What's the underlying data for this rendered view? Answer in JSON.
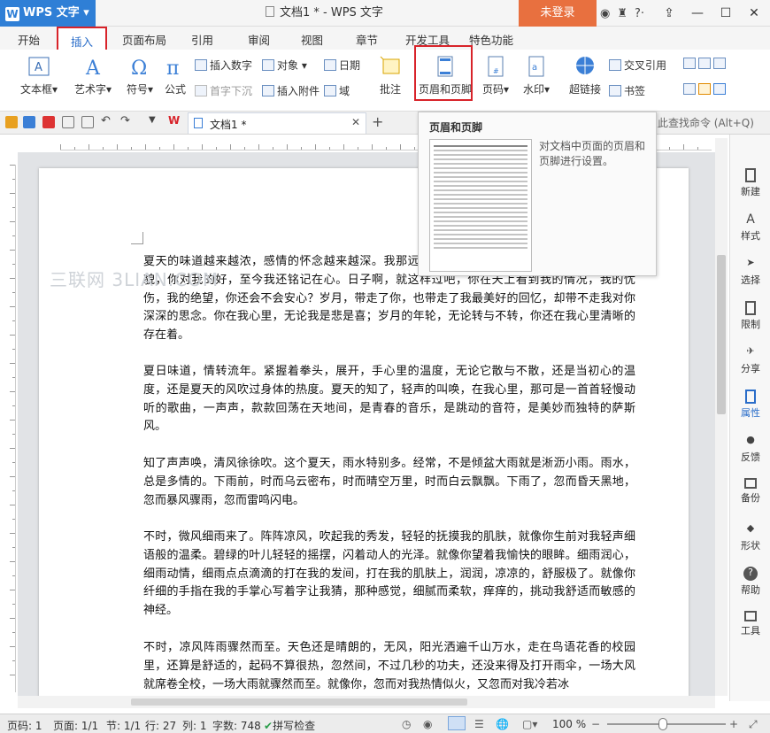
{
  "app": {
    "name": "WPS 文字",
    "window_title": "文档1 * - WPS 文字",
    "login": "未登录"
  },
  "tabs": [
    "开始",
    "插入",
    "页面布局",
    "引用",
    "审阅",
    "视图",
    "章节",
    "开发工具",
    "特色功能"
  ],
  "ribbon": {
    "textbox": "文本框",
    "wordart": "艺术字",
    "symbol": "符号",
    "formula": "公式",
    "insert_number": "插入数字",
    "object": "对象",
    "date": "日期",
    "drop_cap": "首字下沉",
    "insert_attachment": "插入附件",
    "field": "域",
    "comment": "批注",
    "header_footer": "页眉和页脚",
    "page_number": "页码",
    "watermark": "水印",
    "hyperlink": "超链接",
    "cross_ref": "交叉引用",
    "bookmark": "书签"
  },
  "quickbar": {
    "doc_tab": "文档1 *",
    "search_placeholder": "点此查找命令 (Alt+Q)"
  },
  "tooltip": {
    "title": "页眉和页脚",
    "description": "对文档中页面的页眉和页脚进行设置。"
  },
  "document": {
    "watermark": "三联网 3LIAN.COM",
    "paragraphs": [
      "夏天的味道越来越浓，感情的怀念越来越深。我那远去的朋友，你在天国还好吗？你的音容笑貌，你对我的好，至今我还铭记在心。日子啊，就这样过吧，你在天上看到我的情况，我的忧伤，我的绝望，你还会不会安心？岁月，带走了你，也带走了我最美好的回忆，却带不走我对你深深的思念。你在我心里，无论我是悲是喜；岁月的年轮，无论转与不转，你还在我心里清晰的存在着。",
      "夏日味道，情转流年。紧握着拳头，展开，手心里的温度，无论它散与不散，还是当初心的温度，还是夏天的风吹过身体的热度。夏天的知了，轻声的叫唤，在我心里，那可是一首首轻慢动听的歌曲，一声声，款款回荡在天地间，是青春的音乐，是跳动的音符，是美妙而独特的萨斯风。",
      "知了声声唤，清风徐徐吹。这个夏天，雨水特别多。经常，不是倾盆大雨就是淅沥小雨。雨水，总是多情的。下雨前，时而乌云密布，时而晴空万里，时而白云飘飘。下雨了，忽而昏天黑地，忽而暴风骤雨，忽而雷鸣闪电。",
      "不时，微风细雨来了。阵阵凉风，吹起我的秀发，轻轻的抚摸我的肌肤，就像你生前对我轻声细语般的温柔。碧绿的叶儿轻轻的摇摆，闪着动人的光泽。就像你望着我愉快的眼眸。细雨润心，细雨动情，细雨点点滴滴的打在我的发间，打在我的肌肤上，润润，凉凉的，舒服极了。就像你纤细的手指在我的手掌心写着字让我猜，那种感觉，细腻而柔软，痒痒的，挑动我舒适而敏感的神经。",
      "不时，凉风阵雨骤然而至。天色还是晴朗的，无风，阳光洒遍千山万水，走在鸟语花香的校园里，还算是舒适的，起码不算很热，忽然间，不过几秒的功夫，还没来得及打开雨伞，一场大风就席卷全校，一场大雨就骤然而至。就像你，忽而对我热情似火，又忽而对我冷若冰"
    ]
  },
  "right_panel": [
    "新建",
    "样式",
    "选择",
    "限制",
    "分享",
    "属性",
    "反馈",
    "备份",
    "形状",
    "帮助",
    "工具"
  ],
  "status": {
    "page_code": "页码: 1",
    "page": "页面: 1/1",
    "section": "节: 1/1",
    "row": "行: 27",
    "col": "列: 1",
    "word_count": "字数: 748",
    "spell": "拼写检查",
    "zoom": "100 %"
  },
  "colors": {
    "accent": "#2f7fd6",
    "highlight": "#d8232a",
    "login": "#e8703f"
  }
}
